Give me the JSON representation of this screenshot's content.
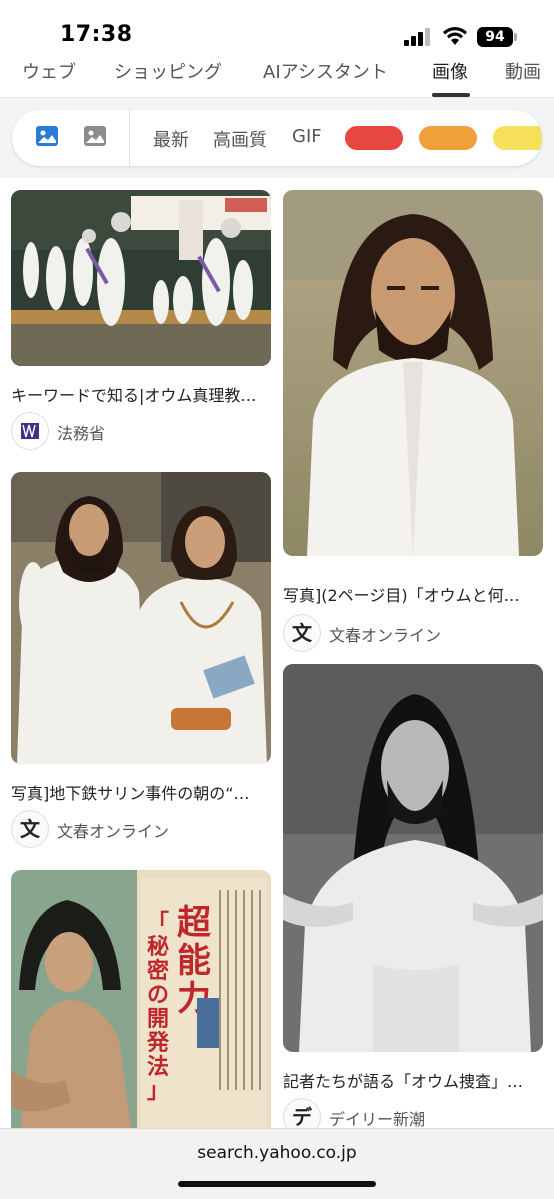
{
  "status": {
    "time": "17:38",
    "battery": "94"
  },
  "tabs": [
    {
      "label": "ウェブ"
    },
    {
      "label": "ショッピング"
    },
    {
      "label": "AIアシスタント"
    },
    {
      "label": "画像"
    },
    {
      "label": "動画"
    }
  ],
  "active_tab": "画像",
  "filters": {
    "icons": [
      "image-filter-icon",
      "photo-filter-icon"
    ],
    "options": [
      "最新",
      "高画質",
      "GIF"
    ],
    "colors": [
      "#e8473f",
      "#f0a03a",
      "#f6e05a"
    ]
  },
  "results": [
    {
      "title": "キーワードで知る|オウム真理教…",
      "source": "法務省",
      "source_icon": "ministry-of-justice-logo"
    },
    {
      "title": "写真](2ページ目)「オウムと何…",
      "source": "文春オンライン",
      "source_icon": "bunshun-logo"
    },
    {
      "title": "写真]地下鉄サリン事件の朝の“…",
      "source": "文春オンライン",
      "source_icon": "bunshun-logo"
    },
    {
      "title": "記者たちが語る「オウム捜査」…",
      "source": "デイリー新潮",
      "source_icon": "daily-shincho-logo"
    },
    {
      "title": "",
      "source": "",
      "source_icon": ""
    }
  ],
  "book_cover": {
    "title": "超能力「秘密の開発法」"
  },
  "icon_glyphs": {
    "bunshun": "文",
    "shincho": "デ"
  },
  "url_bar": {
    "url": "search.yahoo.co.jp"
  }
}
